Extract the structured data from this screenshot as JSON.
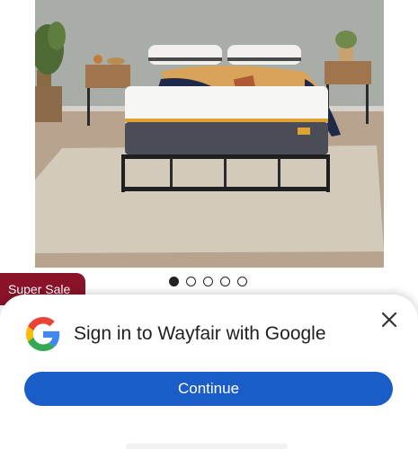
{
  "product": {
    "image_alt": "",
    "carousel": {
      "total": 5,
      "active_index": 0
    },
    "badge": "Super Sale"
  },
  "signin_sheet": {
    "title": "Sign in to Wayfair with Google",
    "continue_label": "Continue",
    "logo_icon": "google-g-logo-icon",
    "close_icon": "close-icon"
  },
  "colors": {
    "badge": "#8b1329",
    "button": "#1a5dc9",
    "google_blue": "#4285F4",
    "google_red": "#EA4335",
    "google_yellow": "#FBBC05",
    "google_green": "#34A853"
  }
}
